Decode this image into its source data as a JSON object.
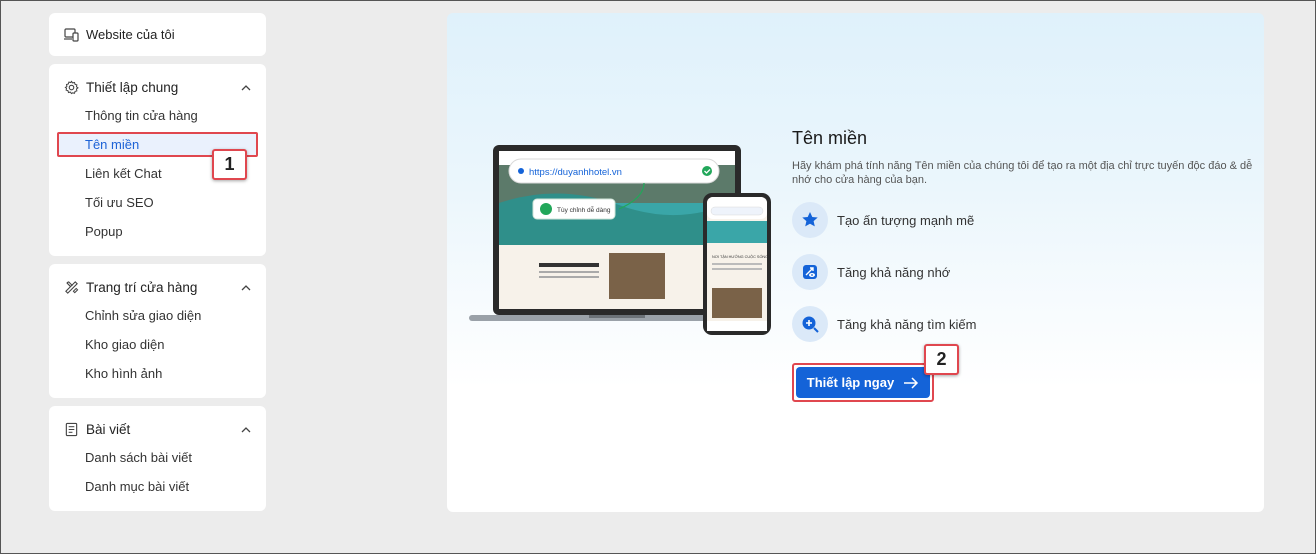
{
  "sidebar": {
    "my_website": "Website của tôi",
    "groups": [
      {
        "title": "Thiết lập chung",
        "items": [
          "Thông tin cửa hàng",
          "Tên miền",
          "Liên kết Chat",
          "Tối ưu SEO",
          "Popup"
        ]
      },
      {
        "title": "Trang trí cửa hàng",
        "items": [
          "Chỉnh sửa giao diện",
          "Kho giao diện",
          "Kho hình ảnh"
        ]
      },
      {
        "title": "Bài viết",
        "items": [
          "Danh sách bài viết",
          "Danh mục bài viết"
        ]
      }
    ],
    "active_item": "Tên miền"
  },
  "markers": {
    "first": "1",
    "second": "2"
  },
  "main": {
    "title": "Tên miền",
    "description": "Hãy khám phá tính năng Tên miền của chúng tôi để tạo ra một địa chỉ trực tuyến độc đáo & dễ nhớ cho cửa hàng của bạn.",
    "features": [
      {
        "label": "Tạo ấn tượng mạnh mẽ",
        "icon": "star-icon"
      },
      {
        "label": "Tăng khả năng nhớ",
        "icon": "eye-arrow-icon"
      },
      {
        "label": "Tăng khả năng tìm kiếm",
        "icon": "search-plus-icon"
      }
    ],
    "cta_label": "Thiết lập ngay",
    "illustration": {
      "url": "https://duyanhhotel.vn",
      "bubble": "Tùy chỉnh dễ dàng",
      "section_title": "NƠI TẬN HƯỞNG CUỘC SỐNG"
    }
  },
  "colors": {
    "accent": "#1463d8",
    "highlight": "#e0474f",
    "active_bg": "#eaf1fd"
  }
}
